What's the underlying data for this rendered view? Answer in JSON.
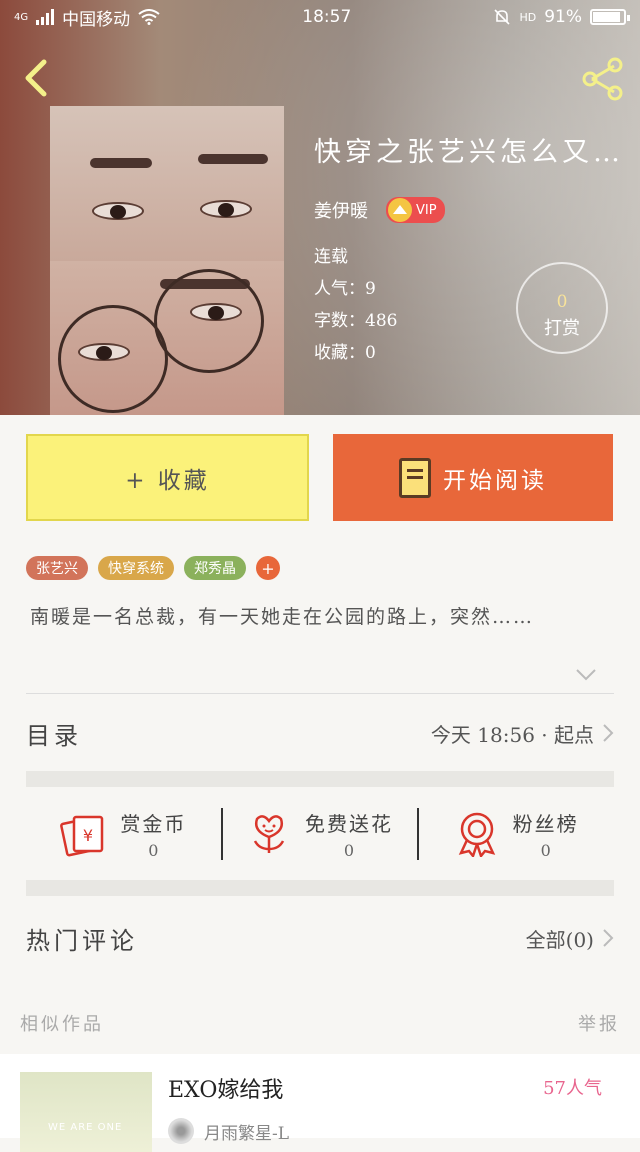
{
  "status_bar": {
    "carrier": "中国移动",
    "net": "4G",
    "time": "18:57",
    "battery_pct": 91,
    "battery_label": "91%",
    "hd": "HD"
  },
  "book": {
    "title": "快穿之张艺兴怎么又…",
    "author": "姜伊暖",
    "vip_label": "VIP",
    "status": "连载",
    "popularity": "人气：9",
    "word_count": "字数：486",
    "favorites": "收藏：0",
    "tip_count": "0",
    "tip_label": "打赏"
  },
  "buttons": {
    "favorite": "+ 收藏",
    "read": "开始阅读"
  },
  "tags": [
    {
      "label": "张艺兴",
      "color": "#d2745a"
    },
    {
      "label": "快穿系统",
      "color": "#d9a74a"
    },
    {
      "label": "郑秀晶",
      "color": "#8bb15c"
    }
  ],
  "tag_add": "+",
  "description": "南暖是一名总裁，有一天她走在公园的路上，突然……",
  "toc": {
    "label": "目录",
    "update": "今天 18:56 · 起点"
  },
  "actions": [
    {
      "title": "赏金币",
      "value": "0",
      "icon": "red-envelope-icon"
    },
    {
      "title": "免费送花",
      "value": "0",
      "icon": "flower-icon"
    },
    {
      "title": "粉丝榜",
      "value": "0",
      "icon": "medal-icon"
    }
  ],
  "comments": {
    "label": "热门评论",
    "all": "全部(0)"
  },
  "similar": {
    "header": "相似作品",
    "report": "举报",
    "items": [
      {
        "title": "EXO嫁给我",
        "popularity": "57人气",
        "author": "月雨繁星-L",
        "cover_text": "WE ARE ONE"
      }
    ]
  },
  "colors": {
    "accent_orange": "#e8673a",
    "fav_yellow": "#fbf27a",
    "icon_red": "#d9362b"
  }
}
